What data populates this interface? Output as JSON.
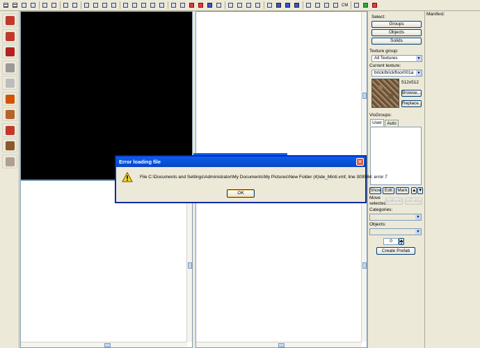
{
  "toolbar": {
    "buttons": [
      "grid",
      "grid-toggle",
      "rect",
      "rect",
      "map",
      "map",
      "undo",
      "redo",
      "cut",
      "copy",
      "paste",
      "cut2",
      "hide",
      "group",
      "ungroup",
      "prefab",
      "scale",
      "texture",
      "apply",
      "carve",
      "hollow",
      "run",
      "texture-app",
      "cordon",
      "vertex",
      "mirror",
      "flip",
      "overlay",
      "blue1",
      "blue2",
      "blue3",
      "split",
      "entities",
      "cubes",
      "helpers",
      "cm",
      "hide-models",
      "green",
      "fit"
    ],
    "cm_label": "CM"
  },
  "tools": [
    "selection",
    "magnify",
    "camera",
    "entity",
    "block",
    "texture-app",
    "apply-decal",
    "overlay",
    "clip",
    "vertex"
  ],
  "right_panel": {
    "select_label": "Select:",
    "groups_button": "Groups",
    "objects_button": "Objects",
    "solids_button": "Solids",
    "texture_group_label": "Texture group:",
    "texture_group_value": "All Textures",
    "current_texture_label": "Current texture:",
    "current_texture_value": "brick/brickfloor001a",
    "texture_size": "512x512",
    "browse_button": "Browse...",
    "replace_button": "Replace...",
    "visgroups_label": "VisGroups:",
    "tab_user": "User",
    "tab_auto": "Auto",
    "show_button": "Show",
    "edit_button": "Edit",
    "mark_button": "Mark",
    "up_arrow": "▲",
    "down_arrow": "▼",
    "move_selected_label": "Move\nselected:",
    "to_world_button": "toWorld",
    "to_entity_button": "toEntity",
    "categories_label": "Categories:",
    "objects_label": "Objects:",
    "count_value": "0",
    "create_prefab_button": "Create Prefab"
  },
  "manifest": {
    "label": "Manifest:"
  },
  "dialog": {
    "title": "Error loading file",
    "message": "File C:\\Documents and Settings\\Administrator\\My Documents\\My Pictures\\New Folder (4)\\de_Minti.vmf, line 309584: error 7",
    "ok_button": "OK",
    "close_glyph": "✕"
  },
  "colors": {
    "titlebar": "#0a5fe8",
    "window_bg": "#ece9d8",
    "viewport_3d": "#000000",
    "viewport_2d": "#ffffff"
  }
}
